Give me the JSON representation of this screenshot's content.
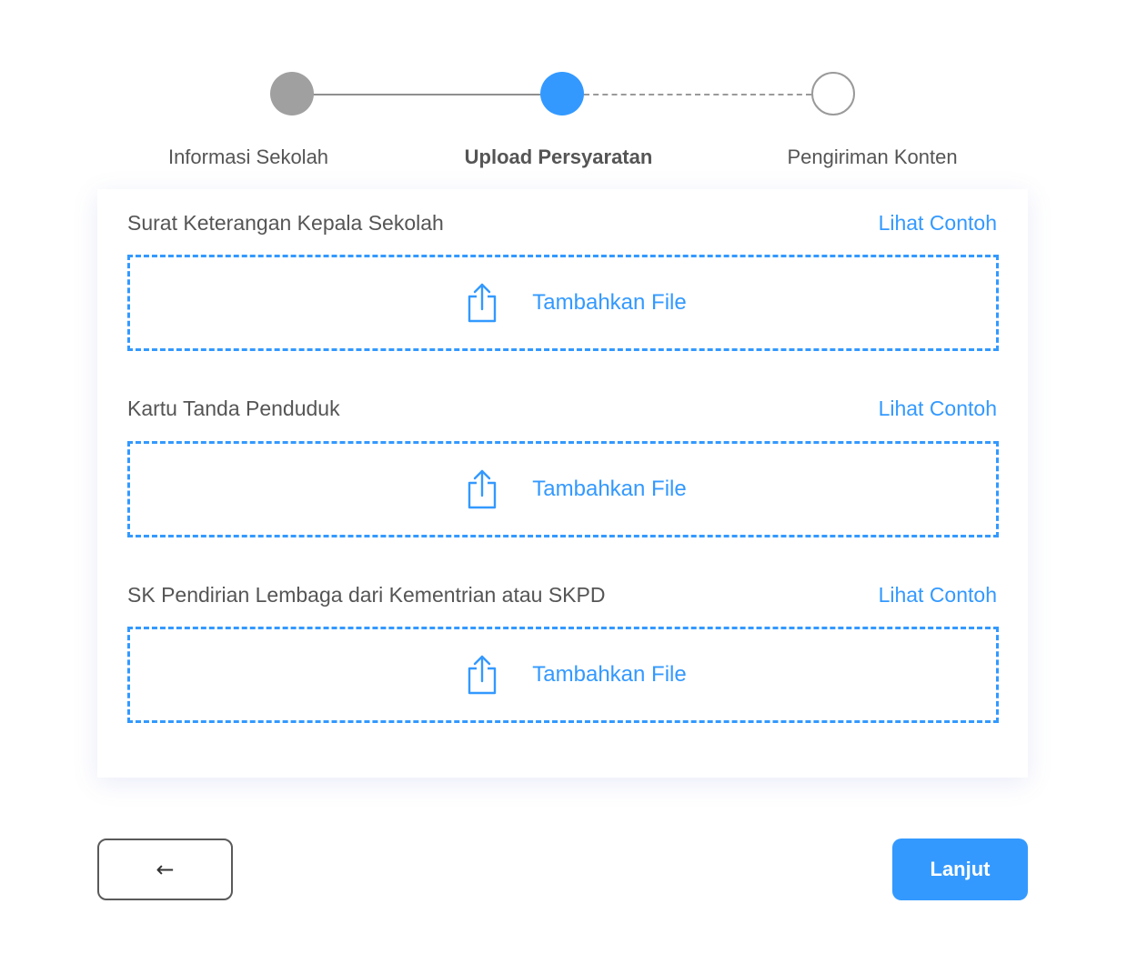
{
  "stepper": {
    "steps": [
      {
        "label": "Informasi Sekolah",
        "state": "done"
      },
      {
        "label": "Upload Persyaratan",
        "state": "active"
      },
      {
        "label": "Pengiriman Konten",
        "state": "pending"
      }
    ]
  },
  "uploads": [
    {
      "title": "Surat Keterangan Kepala Sekolah",
      "example_link": "Lihat Contoh",
      "drop_label": "Tambahkan File",
      "icon": "upload-icon"
    },
    {
      "title": "Kartu Tanda Penduduk",
      "example_link": "Lihat Contoh",
      "drop_label": "Tambahkan File",
      "icon": "upload-icon"
    },
    {
      "title": "SK Pendirian Lembaga dari Kementrian atau SKPD",
      "example_link": "Lihat Contoh",
      "drop_label": "Tambahkan File",
      "icon": "upload-icon"
    }
  ],
  "footer": {
    "back_label": "←",
    "back_icon": "arrow-left-icon",
    "next_label": "Lanjut"
  },
  "colors": {
    "accent": "#3399ff",
    "step_done": "#a0a0a0",
    "text": "#555555"
  }
}
